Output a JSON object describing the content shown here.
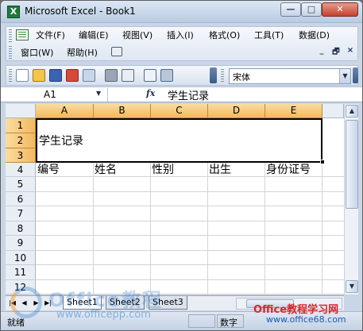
{
  "window": {
    "title": "Microsoft Excel - Book1",
    "app_icon": "excel-icon",
    "controls": {
      "minimize": "—",
      "maximize": "□",
      "close": "✕"
    }
  },
  "menubar": {
    "row1": [
      "文件(F)",
      "编辑(E)",
      "视图(V)",
      "插入(I)",
      "格式(O)",
      "工具(T)",
      "数据(D)"
    ],
    "row2": [
      "窗口(W)",
      "帮助(H)"
    ],
    "mdi": {
      "minimize": "_",
      "restore": "🗗",
      "close": "×"
    }
  },
  "toolbar": {
    "icons": [
      "new-icon",
      "open-icon",
      "save-icon",
      "permission-icon",
      "email-icon",
      "print-icon",
      "print-preview-icon",
      "spelling-icon",
      "research-icon"
    ],
    "font_name": "宋体"
  },
  "formula_bar": {
    "name_box": "A1",
    "fx_label": "fx",
    "content": "学生记录"
  },
  "sheet": {
    "columns": [
      "A",
      "B",
      "C",
      "D",
      "E"
    ],
    "rows": [
      "1",
      "2",
      "3",
      "4",
      "5",
      "6",
      "7",
      "8",
      "9",
      "10",
      "11",
      "12"
    ],
    "merged_cell_text": "学生记录",
    "row4": [
      "编号",
      "姓名",
      "性别",
      "出生",
      "身份证号"
    ]
  },
  "sheet_tabs": {
    "nav": [
      "|◀",
      "◀",
      "▶",
      "▶|"
    ],
    "tabs": [
      "Sheet1",
      "Sheet2",
      "Sheet3"
    ]
  },
  "status": {
    "ready": "就绪",
    "mode": "数字"
  },
  "watermarks": {
    "office": "Office教程",
    "office_url": "www.officepp.com",
    "right": "Office教程学习网",
    "right_url": "www.office68.com"
  },
  "colors": {
    "selected_header": "#f3b860",
    "title_gradient": "#b9cbe2",
    "watermark_red": "#d9262b",
    "watermark_blue": "#1b59b5"
  }
}
